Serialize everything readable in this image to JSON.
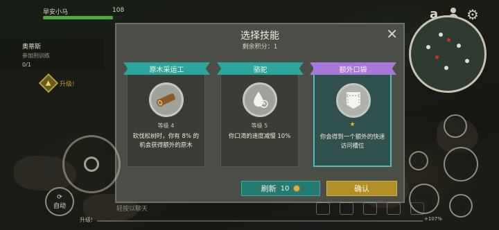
{
  "hud": {
    "player_name": "旱安小马",
    "hp_value": "108",
    "hp_fraction": 0.86,
    "quest_title": "奥蒂斯",
    "quest_sub": "参加刑训练",
    "quest_count": "0/1",
    "levelup_label": "升级!",
    "chat_placeholder": "轻按以聊天",
    "bottom_level_label": "升级!",
    "xp_percent": "+107%",
    "auto_label": "自动"
  },
  "dialog": {
    "title": "选择技能",
    "points_label": "剩余积分：",
    "points_value": "1",
    "close_icon": "✕",
    "cards": [
      {
        "title": "原木采运工",
        "level": "等级 4",
        "description": "砍伐松树时，你有 8% 的机会获得额外的原木",
        "icon": "log-icon",
        "ribbon_color": "#2ea59a",
        "selected": false
      },
      {
        "title": "骆驼",
        "level": "等级 5",
        "description": "你口渴的速度减慢 10%",
        "icon": "water-drop-icon",
        "ribbon_color": "#2ea59a",
        "selected": false
      },
      {
        "title": "额外口袋",
        "level": "★",
        "description": "你会得到一个额外的快速访问槽位",
        "icon": "pocket-icon",
        "ribbon_color": "#a679d8",
        "selected": true
      }
    ],
    "refresh_label": "刷新",
    "refresh_cost": "10",
    "confirm_label": "确认"
  },
  "colors": {
    "teal": "#2ea59a",
    "purple": "#a679d8",
    "gold": "#b08e28",
    "hp": "#4caa3c"
  }
}
